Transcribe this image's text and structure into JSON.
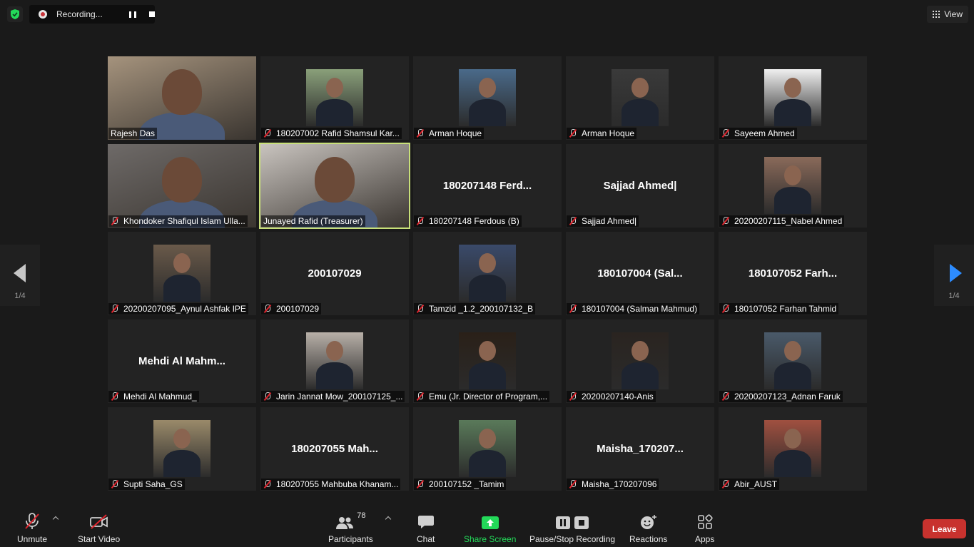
{
  "recording": {
    "label": "Recording..."
  },
  "view": {
    "label": "View"
  },
  "pager": {
    "left": "1/4",
    "right": "1/4"
  },
  "tiles": [
    {
      "label": "Rajesh Das",
      "muted": false,
      "kind": "video",
      "bg": "#a5937d"
    },
    {
      "label": "180207002 Rafid Shamsul Kar...",
      "muted": true,
      "kind": "photo",
      "bg": "#8aa07a"
    },
    {
      "label": "Arman Hoque",
      "muted": true,
      "kind": "photo",
      "bg": "#4a6a8a"
    },
    {
      "label": "Arman Hoque",
      "muted": true,
      "kind": "photo",
      "bg": "#3a3a3a"
    },
    {
      "label": "Sayeem Ahmed",
      "muted": true,
      "kind": "photo",
      "bg": "#f0f0f0"
    },
    {
      "label": "Khondoker Shafiqul Islam Ulla...",
      "muted": true,
      "kind": "video",
      "bg": "#6e6a68"
    },
    {
      "label": "Junayed Rafid (Treasurer)",
      "muted": false,
      "kind": "video",
      "bg": "#c9c4bf",
      "active": true
    },
    {
      "label": "180207148 Ferdous (B)",
      "muted": true,
      "kind": "name",
      "display": "180207148 Ferd..."
    },
    {
      "label": "Sajjad Ahmed|",
      "muted": true,
      "kind": "name",
      "display": "Sajjad Ahmed|"
    },
    {
      "label": "20200207115_Nabel Ahmed",
      "muted": true,
      "kind": "photo",
      "bg": "#8a6a5a"
    },
    {
      "label": "20200207095_Aynul Ashfak IPE",
      "muted": true,
      "kind": "photo",
      "bg": "#6a5a4a"
    },
    {
      "label": "200107029",
      "muted": true,
      "kind": "name",
      "display": "200107029"
    },
    {
      "label": "Tamzid _1.2_200107132_B",
      "muted": true,
      "kind": "photo",
      "bg": "#3a4a6a"
    },
    {
      "label": "180107004 (Salman Mahmud)",
      "muted": true,
      "kind": "name",
      "display": "180107004 (Sal..."
    },
    {
      "label": "180107052 Farhan Tahmid",
      "muted": true,
      "kind": "name",
      "display": "180107052 Farh..."
    },
    {
      "label": "Mehdi Al Mahmud_",
      "muted": true,
      "kind": "name",
      "display": "Mehdi Al Mahm..."
    },
    {
      "label": "Jarin Jannat Mow_200107125_...",
      "muted": true,
      "kind": "photo",
      "bg": "#b8b0a8"
    },
    {
      "label": "Emu (Jr. Director of Program,...",
      "muted": true,
      "kind": "photo",
      "bg": "#2a2018"
    },
    {
      "label": "20200207140-Anis",
      "muted": true,
      "kind": "photo",
      "bg": "#2a2420"
    },
    {
      "label": "20200207123_Adnan Faruk",
      "muted": true,
      "kind": "photo",
      "bg": "#4a5a6a"
    },
    {
      "label": "Supti Saha_GS",
      "muted": true,
      "kind": "photo",
      "bg": "#9a8a6a"
    },
    {
      "label": "180207055 Mahbuba Khanam...",
      "muted": true,
      "kind": "name",
      "display": "180207055 Mah..."
    },
    {
      "label": "200107152 _Tamim",
      "muted": true,
      "kind": "photo",
      "bg": "#5a7a5a"
    },
    {
      "label": "Maisha_170207096",
      "muted": true,
      "kind": "name",
      "display": "Maisha_170207..."
    },
    {
      "label": "Abir_AUST",
      "muted": true,
      "kind": "photo",
      "bg": "#a05040"
    }
  ],
  "toolbar": {
    "unmute": "Unmute",
    "start_video": "Start Video",
    "participants": "Participants",
    "participants_count": "78",
    "chat": "Chat",
    "share_screen": "Share Screen",
    "pause_stop_recording": "Pause/Stop Recording",
    "reactions": "Reactions",
    "apps": "Apps",
    "leave": "Leave"
  },
  "colors": {
    "share_green": "#23d959",
    "leave_red": "#c8322e",
    "active_border": "#c8e079",
    "nav_arrow_blue": "#2d8cff"
  }
}
